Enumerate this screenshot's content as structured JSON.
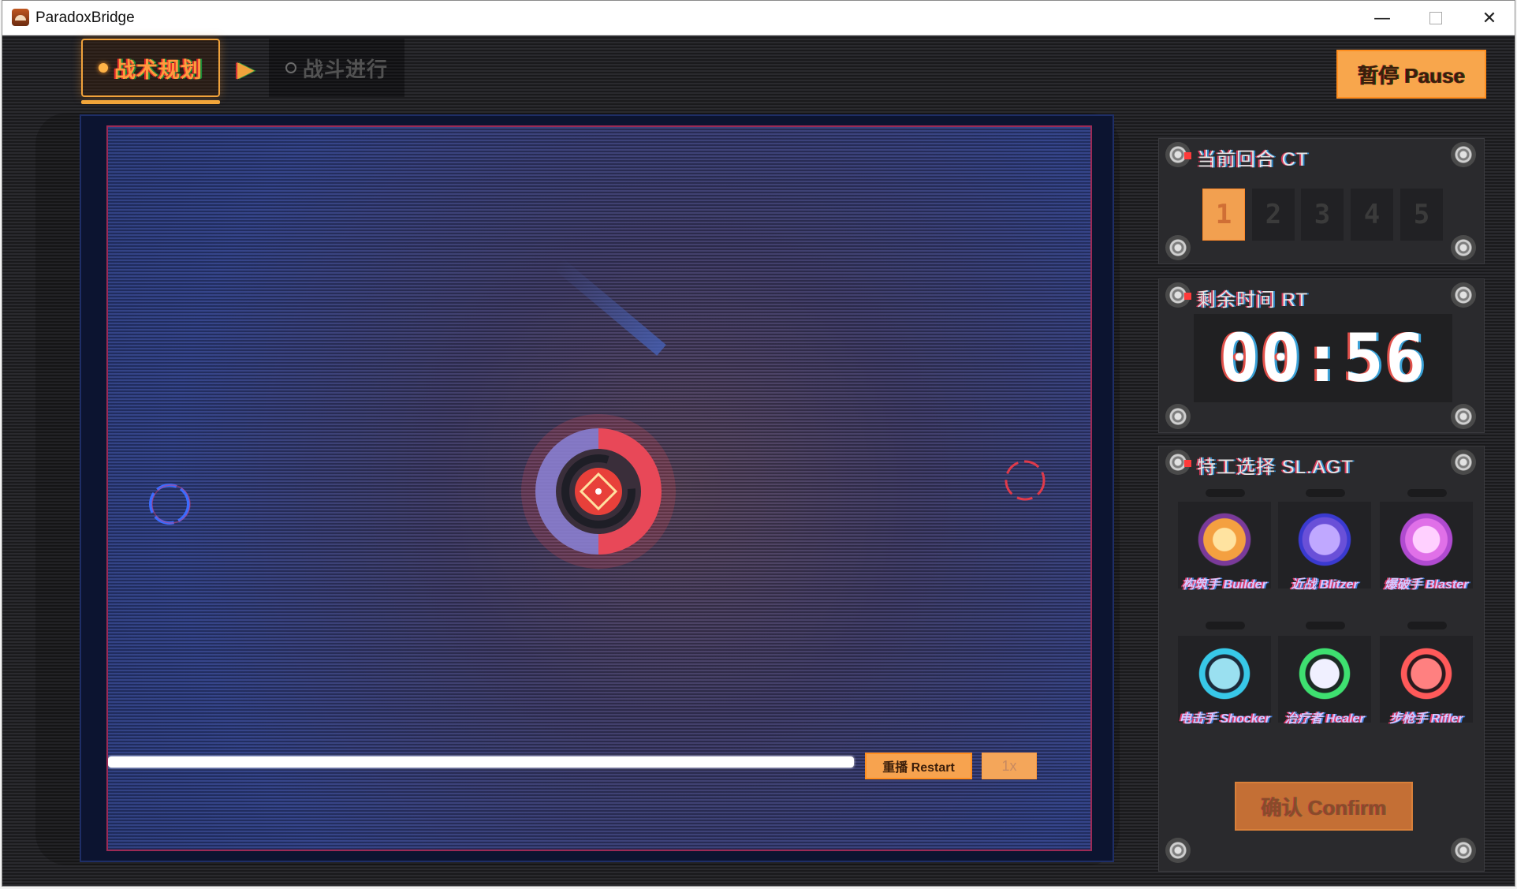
{
  "window": {
    "title": "ParadoxBridge"
  },
  "tabs": {
    "active": "战术规划",
    "inactive": "战斗进行"
  },
  "pause_label": "暂停 Pause",
  "arena": {
    "progress": 1.0
  },
  "controls": {
    "restart_label": "重播 Restart",
    "speed_label": "1x"
  },
  "round_panel": {
    "title": "当前回合 CT",
    "rounds": [
      "1",
      "2",
      "3",
      "4",
      "5"
    ],
    "current": 1
  },
  "timer_panel": {
    "title": "剩余时间 RT",
    "value": "00:56"
  },
  "agent_panel": {
    "title": "特工选择 SL.AGT",
    "agents": [
      {
        "label": "构筑手 Builder",
        "icon": "builder-icon",
        "color": "#f4b04a"
      },
      {
        "label": "近战 Blitzer",
        "icon": "blitzer-icon",
        "color": "#9a7cf0"
      },
      {
        "label": "爆破手 Blaster",
        "icon": "blaster-icon",
        "color": "#e070e8"
      },
      {
        "label": "电击手 Shocker",
        "icon": "shocker-icon",
        "color": "#38c8e8"
      },
      {
        "label": "治疗者 Healer",
        "icon": "healer-icon",
        "color": "#3ee070"
      },
      {
        "label": "步枪手 Rifler",
        "icon": "rifler-icon",
        "color": "#ff5a5a"
      }
    ],
    "confirm_label": "确认 Confirm"
  },
  "colors": {
    "accent": "#f7a34f",
    "background": "#26262a",
    "arena_blue": "#2f3f86",
    "enemy_red": "#e03a4a"
  }
}
